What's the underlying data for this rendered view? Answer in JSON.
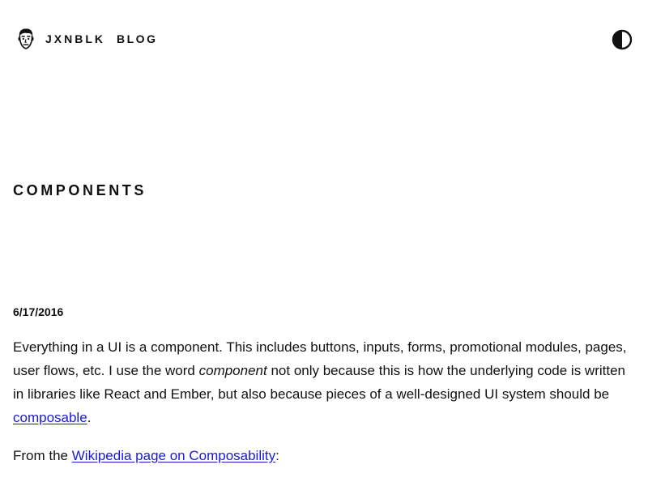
{
  "header": {
    "brand": "JXNBLK",
    "nav": [
      {
        "label": "BLOG"
      }
    ],
    "avatar_icon": "cartoon-face-avatar-icon",
    "theme_toggle_icon": "contrast-half-circle-icon"
  },
  "post": {
    "title": "COMPONENTS",
    "date": "6/17/2016",
    "p1_a": "Everything in a UI is a component. This includes buttons, inputs, forms, promotional modules, pages, user flows, etc. I use the word ",
    "p1_em": "component",
    "p1_b": " not only because this is how the underlying code is written in libraries like React and Ember, but also because pieces of a well-designed UI system should be ",
    "p1_link": "composable",
    "p1_c": ".",
    "p2_a": "From the ",
    "p2_link": "Wikipedia page on Composability",
    "p2_b": ":"
  },
  "colors": {
    "text": "#111111",
    "link": "#1a1ad6",
    "background": "#ffffff"
  }
}
